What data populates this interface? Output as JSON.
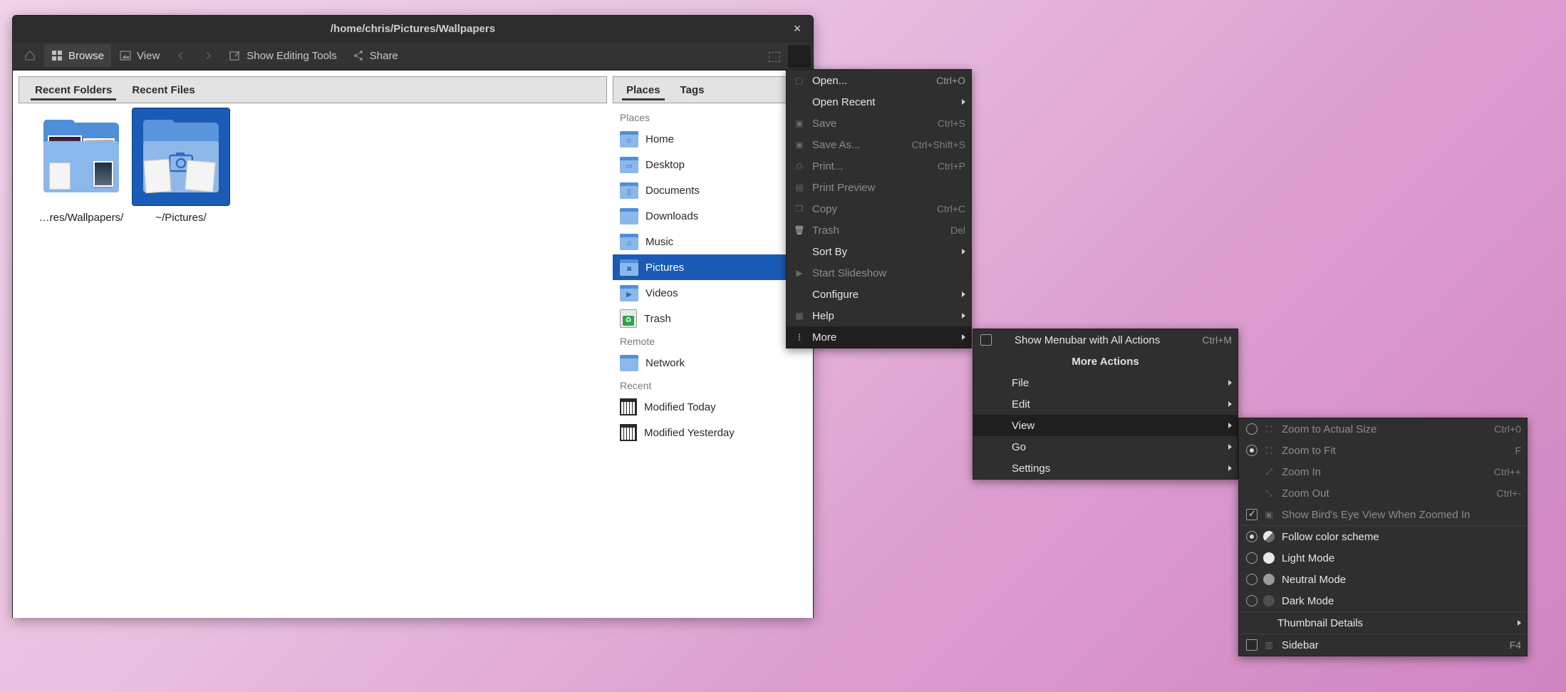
{
  "window": {
    "title": "/home/chris/Pictures/Wallpapers",
    "close_glyph": "×"
  },
  "toolbar": {
    "browse": "Browse",
    "view": "View",
    "show_editing_tools": "Show Editing Tools",
    "share": "Share"
  },
  "left_tabs": [
    "Recent Folders",
    "Recent Files"
  ],
  "right_tabs": [
    "Places",
    "Tags"
  ],
  "tiles": [
    {
      "label": "…res/Wallpapers/"
    },
    {
      "label": "~/Pictures/"
    }
  ],
  "places": {
    "section_places": "Places",
    "items": [
      "Home",
      "Desktop",
      "Documents",
      "Downloads",
      "Music",
      "Pictures",
      "Videos",
      "Trash"
    ],
    "selected": "Pictures",
    "section_remote": "Remote",
    "remote_items": [
      "Network"
    ],
    "section_recent": "Recent",
    "recent_items": [
      "Modified Today",
      "Modified Yesterday"
    ]
  },
  "main_menu": {
    "items": [
      {
        "label": "Open...",
        "shortcut": "Ctrl+O"
      },
      {
        "label": "Open Recent"
      },
      {
        "label": "Save",
        "shortcut": "Ctrl+S"
      },
      {
        "label": "Save As...",
        "shortcut": "Ctrl+Shift+S"
      },
      {
        "label": "Print...",
        "shortcut": "Ctrl+P"
      },
      {
        "label": "Print Preview"
      },
      {
        "label": "Copy",
        "shortcut": "Ctrl+C"
      },
      {
        "label": "Trash",
        "shortcut": "Del"
      },
      {
        "label": "Sort By"
      },
      {
        "label": "Start Slideshow"
      },
      {
        "label": "Configure"
      },
      {
        "label": "Help"
      },
      {
        "label": "More"
      }
    ]
  },
  "more_menu": {
    "show_menubar": "Show Menubar with All Actions",
    "show_menubar_shortcut": "Ctrl+M",
    "header": "More Actions",
    "items": [
      "File",
      "Edit",
      "View",
      "Go",
      "Settings"
    ]
  },
  "view_menu": {
    "items": [
      {
        "label": "Zoom to Actual Size",
        "shortcut": "Ctrl+0"
      },
      {
        "label": "Zoom to Fit",
        "shortcut": "F"
      },
      {
        "label": "Zoom In",
        "shortcut": "Ctrl++"
      },
      {
        "label": "Zoom Out",
        "shortcut": "Ctrl+-"
      },
      {
        "label": "Show Bird's Eye View When Zoomed In"
      },
      {
        "label": "Follow color scheme"
      },
      {
        "label": "Light Mode"
      },
      {
        "label": "Neutral Mode"
      },
      {
        "label": "Dark Mode"
      },
      {
        "label": "Thumbnail Details"
      },
      {
        "label": "Sidebar",
        "shortcut": "F4"
      }
    ]
  },
  "colors": {
    "selection": "#1a5bb5",
    "menu_bg": "#2f2f2f",
    "folder_blue": "#4f8fd9"
  }
}
